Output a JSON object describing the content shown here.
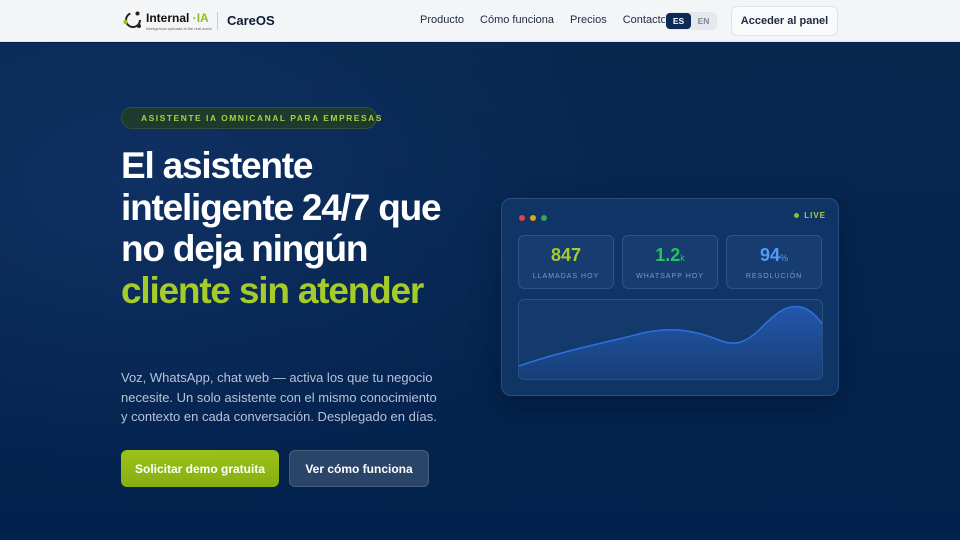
{
  "nav": {
    "logo_text": "Internal",
    "logo_accent": "IA",
    "logo_tagline": "Inteligencia aplicada al the real world",
    "brand": "CareOS",
    "links": [
      "Producto",
      "Cómo funciona",
      "Precios",
      "Contacto"
    ],
    "lang_active": "ES",
    "lang_other": "EN",
    "panel_button": "Acceder al panel"
  },
  "hero": {
    "badge": "ASISTENTE IA OMNICANAL PARA EMPRESAS",
    "headline_plain": "El asistente inteligente 24/7 que no deja ningún ",
    "headline_highlight": "cliente sin atender",
    "lead": "Voz, WhatsApp, chat web — activa los que tu negocio necesite. Un solo asistente con el mismo conocimiento y contexto en cada conversación. Desplegado en días.",
    "cta_primary": "Solicitar demo gratuita",
    "cta_secondary": "Ver cómo funciona"
  },
  "dashboard": {
    "live_label": "LIVE",
    "stats": [
      {
        "value": "847",
        "unit": "",
        "label": "LLAMADAS HOY",
        "color": "#a6cc2a"
      },
      {
        "value": "1.2",
        "unit": "k",
        "label": "WHATSAPP HOY",
        "color": "#22c55e"
      },
      {
        "value": "94",
        "unit": "%",
        "label": "RESOLUCIÓN",
        "color": "#4f9bf7"
      }
    ],
    "window_dot_colors": [
      "#e0443e",
      "#e3a21a",
      "#34a853"
    ]
  },
  "colors": {
    "accent": "#a6cc2a",
    "navy": "#04224f",
    "chart_line": "#2f6fe0"
  }
}
